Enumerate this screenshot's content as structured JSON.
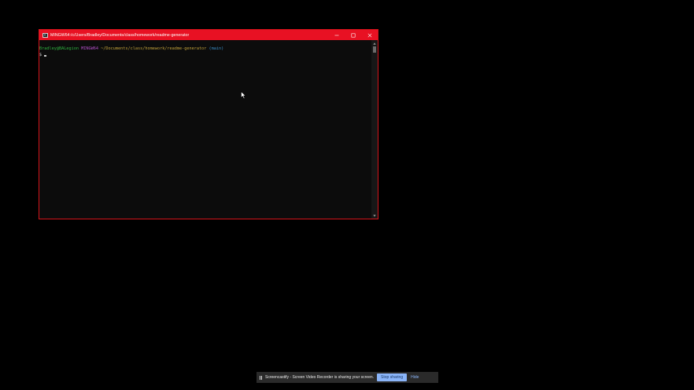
{
  "terminal": {
    "title": "MINGW64:/c/Users/Bradley/Documents/class/homework/readme-generator",
    "prompt": {
      "user_host": "Bradley@BALegion",
      "shell": "MINGW64",
      "path": "~/Documents/class/homework/readme-generator",
      "branch": "(main)",
      "symbol": "$"
    },
    "colors": {
      "titlebar": "#e81123",
      "user_host": "#2fb23f",
      "shell": "#b450c8",
      "path": "#c2a23a",
      "branch": "#3b8ec8"
    }
  },
  "window_controls": {
    "minimize": "minimize-icon",
    "maximize": "maximize-icon",
    "close": "close-icon"
  },
  "share_bar": {
    "pause_icon": "pause-icon",
    "message": "Screencastify - Screen Video Recorder is sharing your screen.",
    "stop_label": "Stop sharing",
    "hide_label": "Hide"
  }
}
